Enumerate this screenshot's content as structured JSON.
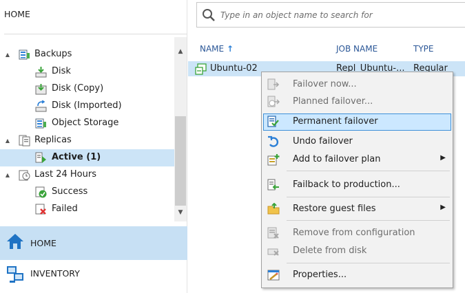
{
  "left_pane": {
    "header_title": "HOME",
    "tree": [
      {
        "label": "Backups",
        "icon": "backups-icon",
        "expander": "▲"
      },
      {
        "label": "Disk",
        "icon": "disk-backup-icon"
      },
      {
        "label": "Disk (Copy)",
        "icon": "disk-copy-icon"
      },
      {
        "label": "Disk (Imported)",
        "icon": "disk-imported-icon"
      },
      {
        "label": "Object Storage",
        "icon": "object-storage-icon"
      },
      {
        "label": "Replicas",
        "icon": "replicas-icon",
        "expander": "▲"
      },
      {
        "label": "Active (1)",
        "icon": "active-replica-icon"
      },
      {
        "label": "Last 24 Hours",
        "icon": "last-24-hours-icon",
        "expander": "▲"
      },
      {
        "label": "Success",
        "icon": "success-icon"
      },
      {
        "label": "Failed",
        "icon": "failed-icon"
      }
    ],
    "scroll_up": "▲",
    "scroll_down": "▼",
    "nav": {
      "home_label": "HOME",
      "inventory_label": "INVENTORY"
    }
  },
  "right_pane": {
    "search_placeholder": "Type in an object name to search for",
    "columns": {
      "name": "NAME",
      "sort_arrow": "↑",
      "job_name": "JOB NAME",
      "type": "TYPE"
    },
    "rows": [
      {
        "name": "Ubuntu-02",
        "job_name": "Repl_Ubuntu-...",
        "type": "Regular"
      }
    ]
  },
  "context_menu": {
    "items": [
      {
        "label": "Failover now...",
        "icon": "failover-now-icon",
        "disabled": true
      },
      {
        "label": "Planned failover...",
        "icon": "planned-failover-icon",
        "disabled": true
      },
      {
        "label": "Permanent failover",
        "icon": "permanent-failover-icon",
        "highlighted": true
      },
      {
        "label": "Undo failover",
        "icon": "undo-failover-icon"
      },
      {
        "label": "Add to failover plan",
        "icon": "add-to-failover-plan-icon",
        "submenu": "▶"
      },
      {
        "label": "Failback to production...",
        "icon": "failback-icon"
      },
      {
        "label": "Restore guest files",
        "icon": "restore-guest-files-icon",
        "submenu": "▶"
      },
      {
        "label": "Remove from configuration",
        "icon": "remove-from-configuration-icon",
        "disabled": true
      },
      {
        "label": "Delete from disk",
        "icon": "delete-from-disk-icon",
        "disabled": true
      },
      {
        "label": "Properties...",
        "icon": "properties-icon"
      }
    ]
  },
  "colors": {
    "selection": "#cce4f7",
    "nav_selected": "#c7e0f4",
    "menu_highlight": "#cce8ff",
    "menu_highlight_border": "#3d8fd8",
    "accent_green": "#4caf50",
    "accent_blue": "#2b7fd6"
  }
}
